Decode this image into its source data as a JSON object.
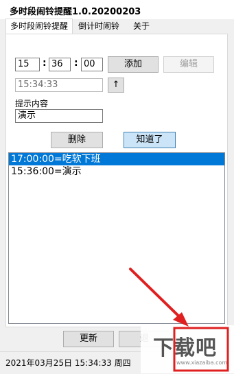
{
  "window": {
    "title": "多时段闹铃提醒1.0.20200203"
  },
  "tabs": [
    {
      "label": "多时段闹铃提醒",
      "active": true
    },
    {
      "label": "倒计时闹铃",
      "active": false
    },
    {
      "label": "关于",
      "active": false
    }
  ],
  "time_inputs": {
    "hour": "15",
    "minute": "36",
    "second": "00",
    "separator": ":"
  },
  "buttons": {
    "add": "添加",
    "edit": "编辑",
    "up_arrow": "↑",
    "delete": "删除",
    "acknowledge": "知道了",
    "refresh": "更新",
    "exit_partial": "退"
  },
  "current_time_field": "15:34:33",
  "reminder": {
    "label": "提示内容",
    "value": "演示"
  },
  "alarm_list": [
    {
      "text": "17:00:00=吃软下班",
      "selected": true
    },
    {
      "text": "15:36:00=演示",
      "selected": false
    }
  ],
  "status_bar": {
    "text": "2021年03月25日 15:34:33 周四"
  },
  "watermark": {
    "text": "下载吧",
    "sub": "www.xiazaiba.com"
  },
  "colors": {
    "selection": "#0078d7",
    "annotation_arrow": "#e02020"
  }
}
